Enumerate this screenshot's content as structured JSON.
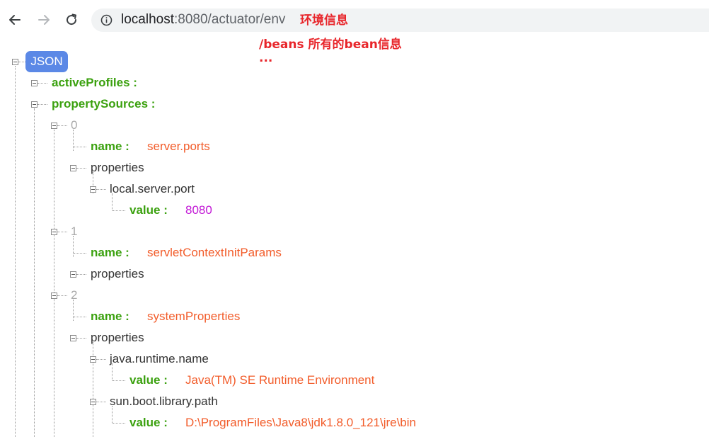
{
  "browser": {
    "url_host": "localhost",
    "url_rest": ":8080/actuator/env"
  },
  "annotations": {
    "line1": "环境信息",
    "line2": "/beans  所有的bean信息",
    "line3": "..."
  },
  "tree": {
    "root": "JSON",
    "active_profiles_key": "activeProfiles :",
    "property_sources_key": "propertySources :",
    "sources": [
      {
        "index": "0",
        "name_key": "name :",
        "name_value": "server.ports",
        "properties_label": "properties",
        "props": [
          {
            "key": "local.server.port",
            "value_key": "value :",
            "value": "8080"
          }
        ]
      },
      {
        "index": "1",
        "name_key": "name :",
        "name_value": "servletContextInitParams",
        "properties_label": "properties"
      },
      {
        "index": "2",
        "name_key": "name :",
        "name_value": "systemProperties",
        "properties_label": "properties",
        "props": [
          {
            "key": "java.runtime.name",
            "value_key": "value :",
            "value": "Java(TM) SE Runtime Environment"
          },
          {
            "key": "sun.boot.library.path",
            "value_key": "value :",
            "value": "D:\\ProgramFiles\\Java8\\jdk1.8.0_121\\jre\\bin"
          }
        ]
      }
    ]
  },
  "colors": {
    "key": "#3ba10f",
    "string": "#f25c2a",
    "number": "#c219d6",
    "index": "#a9a9a9",
    "annotation": "#e8262b",
    "badge": "#5b88e6"
  }
}
